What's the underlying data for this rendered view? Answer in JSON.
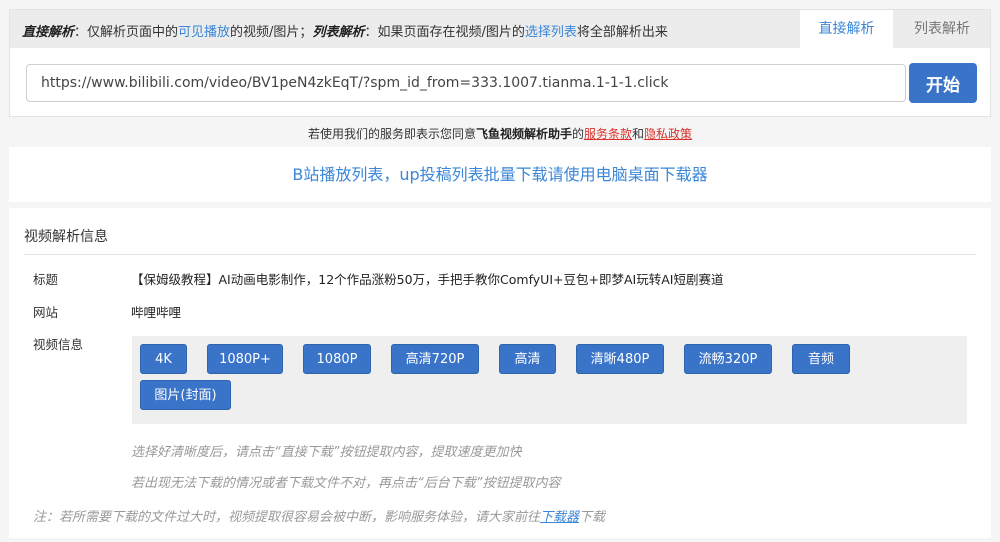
{
  "header": {
    "direct_title": "直接解析",
    "direct_text_1": "：仅解析页面中的",
    "direct_hl": "可见播放",
    "direct_text_2": "的视频/图片；",
    "list_title": "列表解析",
    "list_text_1": "：如果页面存在视频/图片的",
    "list_hl": "选择列表",
    "list_text_2": "将全部解析出来",
    "tab_direct": "直接解析",
    "tab_list": "列表解析"
  },
  "search": {
    "url_value": "https://www.bilibili.com/video/BV1peN4zkEqT/?spm_id_from=333.1007.tianma.1-1-1.click",
    "start_label": "开始"
  },
  "agreement": {
    "prefix": "若使用我们的服务即表示您同意",
    "brand": "飞鱼视频解析助手",
    "mid1": "的",
    "terms": "服务条款",
    "mid2": "和",
    "privacy": "隐私政策"
  },
  "banner": {
    "text": "B站播放列表，up投稿列表批量下载请使用电脑桌面下载器"
  },
  "info": {
    "section_title": "视频解析信息",
    "title_label": "标题",
    "title_value": "【保姆级教程】AI动画电影制作，12个作品涨粉50万，手把手教你ComfyUI+豆包+即梦AI玩转AI短剧赛道",
    "site_label": "网站",
    "site_value": "哔哩哔哩",
    "video_label": "视频信息",
    "qualities": [
      "4K",
      "1080P+",
      "1080P",
      "高清720P",
      "高清",
      "清晰480P",
      "流畅320P",
      "音频",
      "图片(封面)"
    ],
    "hint1": "选择好清晰度后，请点击“直接下载”按钮提取内容，提取速度更加快",
    "hint2": "若出现无法下载的情况或者下载文件不对，再点击“后台下载”按钮提取内容",
    "note_prefix": "注：若所需要下载的文件过大时，视频提取很容易会被中断，影响服务体验，请大家前往",
    "note_link": "下载器",
    "note_suffix": "下载"
  }
}
